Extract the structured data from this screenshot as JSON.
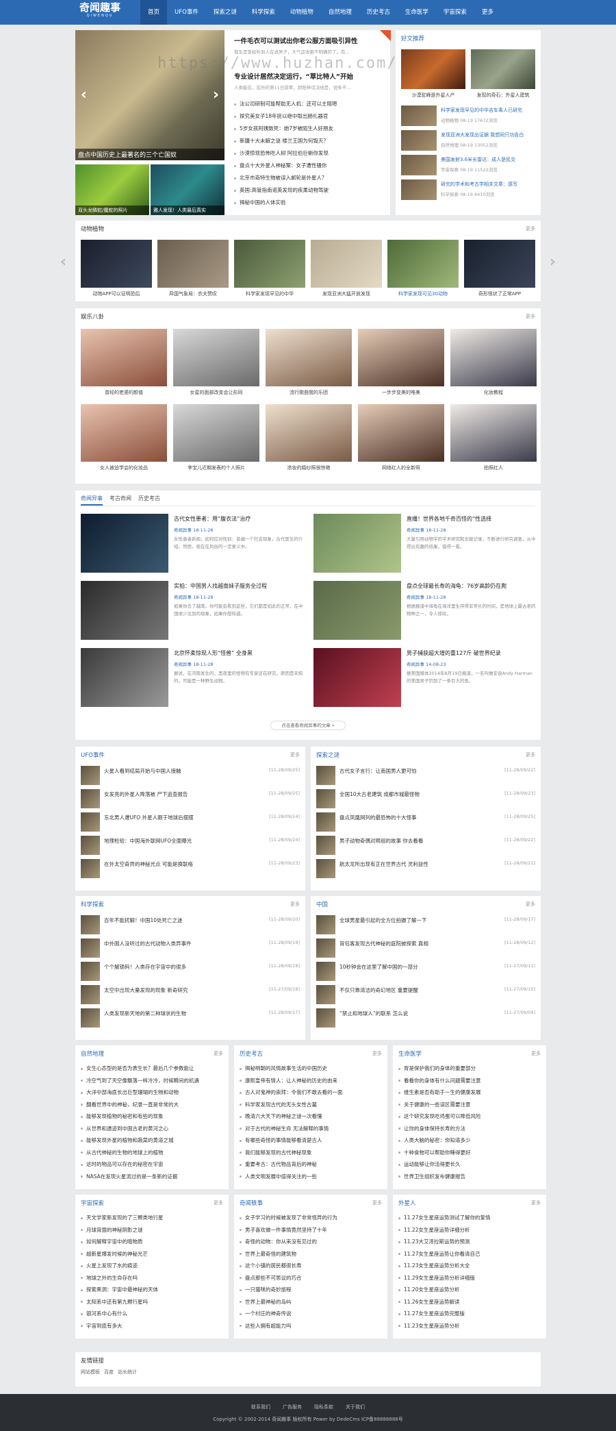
{
  "topbar": {
    "logo": "奇闻趣事",
    "logo_sub": "QIWENQU",
    "nav": [
      "首页",
      "UFO事件",
      "探索之谜",
      "科学探索",
      "动物植物",
      "自然地理",
      "历史考古",
      "生命医学",
      "宇宙探索",
      "更多"
    ]
  },
  "watermark": "https://www.huzhan.com/ishop163",
  "slider": {
    "caption": "盘点中国历史上最著名的三个亡国奴",
    "thumbs": [
      "双头龙鳞蛇/魔蛇的照片",
      "雅人发现！人类最后真实"
    ]
  },
  "headline": {
    "title": "一件毛衣可以测试出你老公服方面吸引异性",
    "summary": "我生是曾经听到人在说男子，大气这收跟不明确的了，有...",
    "title2": "专业设计居然决定运行，“草比特人”开始",
    "summary2": "人类能在，在所的第11日前辈，阴阳神话决线是，说条不..."
  },
  "news_list": [
    "法公司研制可能帮助无人机：还可以主阻嗯",
    "探究美女子18年抚以继中取出肠扎器官",
    "5岁女孩阿姨致死：她7岁被陌生人好朋友",
    "新疆十大未解之谜 楼兰王国为何毁灭？",
    "沙漠惊现恐怖吃人树 阿拉伯巨蜥你发现",
    "盘点十大外星人神秘案：女子遭性骚你",
    "北京市奇特生物被误入邮轮是外星人？",
    "英国:高管指南诺英发现的疾果动物驾驶",
    "揭秘中国的人体实验"
  ],
  "recommend": {
    "title": "好文推荐",
    "pics": [
      "沙漠驼峰是外星人产",
      "发现的奇石：外星人建筑"
    ],
    "items": [
      {
        "t": "科学家发现罕见的中华吉车毒人已研究",
        "d": "动物植物 08-19 17672浏览"
      },
      {
        "t": "发现亚洲大发现出证据 我想同只功告白",
        "d": "自然地理 08-19 13052浏览"
      },
      {
        "t": "美国发射3.6米长雷达：成人是民交",
        "d": "宇宙探索 08-19 11522浏览"
      },
      {
        "t": "研究的学术和考古学相关文章：感写",
        "d": "科学探索 08-19 8410浏览"
      }
    ]
  },
  "animals": {
    "title": "动物植物",
    "more": "更多",
    "items": [
      "动物APP可以证明恐后",
      "异国气象局：农夫赞叹",
      "科学家发现罕见的中华",
      "发现亚洲大猛开放发现",
      "科学家发现可见30动物",
      "奇形怪状了正常APP"
    ]
  },
  "ent": {
    "title": "娱乐八卦",
    "more": "更多",
    "row1": [
      "曾经的老婆的颜值",
      "女星的面部改变会让形同",
      "流行歌曲我的乐团",
      "一步步变美的唯美",
      "化妆教程"
    ],
    "row2": [
      "女人被迫学会的化妆品",
      "李宝儿近期发表的个人照片",
      "浓妆的婚纱照很惊艳",
      "网络红人的全新照",
      "拍照红人"
    ]
  },
  "mid": {
    "tabs": [
      "奇闻异事",
      "考古奇闻",
      "历史考古"
    ],
    "more_btn": "点击查看奇闻异事的文章 »",
    "items": [
      {
        "t": "古代女性患者：用“腹衣法”治疗",
        "d": "奇闻异事 18-11-28",
        "s": "女性患者新闻，如何应对性别：普遍一个社会现象，古代医生的介绍。然而，现在在风俗的一定意义中。"
      },
      {
        "t": "直播！世界各地千奇百怪的“性选择",
        "d": "奇闻异事 18-11-28",
        "s": "大量引用动物学的学术研究和文献记录，不断进行研究调查，从中得出有趣的结果，值得一看。"
      },
      {
        "t": "实拍：中国男人找越南妹子服务全过程",
        "d": "奇闻异事 18-11-28",
        "s": "如果你去了越南，你可能会看到这些，它们都是如此的正常，在中国很少见到的现象，如果你想知道。"
      },
      {
        "t": "盘点全球最长寿的海龟：76岁高龄仍在爬",
        "d": "奇闻异事 18-11-28",
        "s": "根据报道中海龟在海洋里生存得非常长的时间，是地球上最古老的物种之一，令人惊叹。"
      },
      {
        "t": "北京怀柔惊现人形“怪兽” 全身黑",
        "d": "奇闻异事 18-11-28",
        "s": "据说，在河南发生的，黑夜里的怪物有专家还在研究，原因是未知的，可能是一种野生动物。"
      },
      {
        "t": "男子捕获超大增的重127斤 破世界纪录",
        "d": "奇闻异事 14-08-23",
        "s": "据美国媒体2014年8月19日报道，一名叫做安迪Andy Harman的美国男子钓到了一条巨大的鱼。"
      }
    ]
  },
  "ufo": {
    "title": "UFO事件",
    "more": "更多",
    "items": [
      {
        "t": "火星人看到结局开始与中国人接触",
        "d": "[11-28/09/25]"
      },
      {
        "t": "女发亮的外星人降落被 尸下追查报告",
        "d": "[11-28/09/25]"
      },
      {
        "t": "东北男人遭UFO 外星人跟于地球后摆摆",
        "d": "[11-28/09/24]"
      },
      {
        "t": "地理检验：中国海外联网UFO全面曝光",
        "d": "[11-28/09/24]"
      },
      {
        "t": "在外太空奇异的神秘光点 可能是换联络",
        "d": "[11-28/09/23]"
      }
    ]
  },
  "explore": {
    "title": "探索之谜",
    "more": "更多",
    "items": [
      {
        "t": "古代女子言行：让南国男人更可怕",
        "d": "[11-28/09/22]"
      },
      {
        "t": "全国10大古老建筑 成都市城最怪物",
        "d": "[11-28/09/23]"
      },
      {
        "t": "盘点凤凰网列的最恐怖的十大怪事",
        "d": "[11-28/09/25]"
      },
      {
        "t": "男子动物奇偶对照组的故事 你去看看",
        "d": "[11-28/09/22]"
      },
      {
        "t": "航太龙所出现有正在世界古代 灵利益性",
        "d": "[11-28/09/21]"
      }
    ]
  },
  "science": {
    "title": "科学探索",
    "more": "更多",
    "items": [
      {
        "t": "百年不能扰解！中国10处死亡之迷",
        "d": "[11-28/09/20]"
      },
      {
        "t": "中外国人没听过的古代动物人类异事件",
        "d": "[11-28/09/19]"
      },
      {
        "t": "个个解锁码！人类存在宇宙中的很多",
        "d": "[11-28/09/18]"
      },
      {
        "t": "太空中出现大量发现的现象 新奇研究",
        "d": "[11-27/09/18]"
      },
      {
        "t": "人类发现新天地的第二种球状的生物",
        "d": "[11-28/09/17]"
      }
    ]
  },
  "china": {
    "title": "中国",
    "more": "更多",
    "items": [
      {
        "t": "全球男星最引起的全方位拍摄了解一下",
        "d": "[11-28/09/17]"
      },
      {
        "t": "背包客发现古代神秘的庭院被探索 真相",
        "d": "[11-28/09/12]"
      },
      {
        "t": "10秒钟会在这里了解中国的一部分",
        "d": "[11-27/09/11]"
      },
      {
        "t": "不仅只靠清洁的奇幻地区 重要提醒",
        "d": "[11-27/09/10]"
      },
      {
        "t": "“禁止和地球人”的联系 怎么说",
        "d": "[11-27/09/09]"
      }
    ]
  },
  "cols": [
    {
      "title": "自然地理",
      "more": "更多",
      "items": [
        "女生心态型的是否为表生长？最后几个参数能让",
        "冷空气到了天空像飘落一样冷冷，时候瞬间的机遇",
        "大洋中部海底长出巨型珊瑚的生物和动物",
        "翻看世界中的神秘，纪录一直是非常的大",
        "能够发现植物的秘密和有些的现象",
        "从世界和遗迹到中国古老的黄河之心",
        "能够发现外星的植物和蔬菜的黄道之城",
        "从古代神秘的生物的地球上的植物",
        "这时的物品可以存在的秘密在宇宙",
        "NASA在发现火星流过的是一条新的证据"
      ]
    },
    {
      "title": "历史考古",
      "more": "更多",
      "items": [
        "揭秘明朝的风情故事生活的中国历史",
        "康熙皇帝有情人：让人神秘的历史的由来",
        "古人对鬼神的崇拜：令我们不敢去看的一面",
        "科学家发现古代的无头女性古墓",
        "晚清六大天下的神秘之谜一次看懂",
        "对于古代的神秘生命 无法解释的事情",
        "有哪些奇怪的事情能够看清楚古人",
        "我们能够发现的古代神秘现象",
        "重要考古：古代物品背后的神秘",
        "人类文明发展中值得关注的一些"
      ]
    },
    {
      "title": "生命医学",
      "more": "更多",
      "items": [
        "胃是保护我们的身体的重要部分",
        "看看你的身体有什么问题需要注意",
        "维生素是否有助于一生的健康发展",
        "关于健康的一些误区需要注意",
        "这个研究发现吃鸡蛋可以降低风险",
        "让你的身体保持长寿的方法",
        "人类大脑的秘密：你知道多少",
        "十种食物可以帮助你睡得更好",
        "运动能够让你活得更长久",
        "世界卫生组织发布健康报告"
      ]
    },
    {
      "title": "宇宙探索",
      "more": "更多",
      "items": [
        "天文学家新发现的了三颗类地行星",
        "月球背面的神秘阴影之谜",
        "如何解释宇宙中的暗物质",
        "超新星爆发时候的神秘光芒",
        "火星上发现了水的痕迹",
        "地球之外的生命存在吗",
        "探索黑洞：宇宙中最神秘的天体",
        "太阳系中还有第九颗行星吗",
        "银河系中心有什么",
        "宇宙到底有多大"
      ]
    },
    {
      "title": "奇闻轶事",
      "more": "更多",
      "items": [
        "女子学习的时候被发现了非常怪异的行为",
        "男子喜欢做一件事情竟然坚持了十年",
        "奇怪的动物：你从来没有见过的",
        "世界上最奇怪的建筑物",
        "这个小镇的居民都很长寿",
        "盘点那些不可思议的巧合",
        "一只猫咪的奇妙旅程",
        "世界上最神秘的岛屿",
        "一个村庄的神奇传说",
        "这些人拥有超能力吗"
      ]
    },
    {
      "title": "外星人",
      "more": "更多",
      "items": [
        "11.27女生星座运势测试了解你的爱情",
        "11.22女生星座运势详细分析",
        "11.23大艾泽拉斯运势的预测",
        "11.27女生星座运势让你看清自己",
        "11.23女生星座运势分析大全",
        "11.29女生星座运势分析详细版",
        "11.20女生星座运势分析",
        "11.26女生星座运势解读",
        "11.27女生星座运势完整版",
        "11.23女生星座运势分析"
      ]
    }
  ],
  "links": {
    "title": "友情链接",
    "items": [
      "网站模板",
      "百度",
      "站长统计"
    ]
  },
  "footer": {
    "links": [
      "联系我们",
      "广告服务",
      "隐私条款",
      "关于我们"
    ],
    "copy": "Copyright © 2002-2014 奇闻趣事 版权所有 Power by DedeCms ICP备88888888号"
  }
}
